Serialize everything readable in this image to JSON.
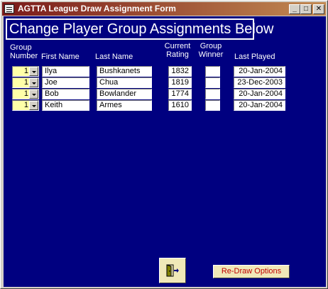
{
  "window": {
    "title": "AGTTA League Draw Assignment Form",
    "min_glyph": "_",
    "max_glyph": "□",
    "close_glyph": "✕"
  },
  "banner": {
    "text": "Change Player Group Assignments Below"
  },
  "headers": {
    "group_number_line1": "Group",
    "group_number_line2": "Number",
    "first_name": "First Name",
    "last_name": "Last Name",
    "current_rating_line1": "Current",
    "current_rating_line2": "Rating",
    "group_winner_line1": "Group",
    "group_winner_line2": "Winner",
    "last_played": "Last Played"
  },
  "rows": [
    {
      "group": "1",
      "first": "Ilya",
      "last": "Bushkanets",
      "rating": "1832",
      "winner": "",
      "last_played": "20-Jan-2004"
    },
    {
      "group": "1",
      "first": "Joe",
      "last": "Chua",
      "rating": "1819",
      "winner": "",
      "last_played": "23-Dec-2003"
    },
    {
      "group": "1",
      "first": "Bob",
      "last": "Bowlander",
      "rating": "1774",
      "winner": "",
      "last_played": "20-Jan-2004"
    },
    {
      "group": "1",
      "first": "Keith",
      "last": "Armes",
      "rating": "1610",
      "winner": "",
      "last_played": "20-Jan-2004"
    }
  ],
  "buttons": {
    "exit_icon": "exit-door-icon",
    "redraw_label": "Re-Draw Options"
  },
  "colors": {
    "form_background": "#000080",
    "title_gradient_start": "#7a1a1a",
    "title_gradient_end": "#c28a52",
    "combo_background": "#ffffa8",
    "redraw_text": "#c00000"
  }
}
